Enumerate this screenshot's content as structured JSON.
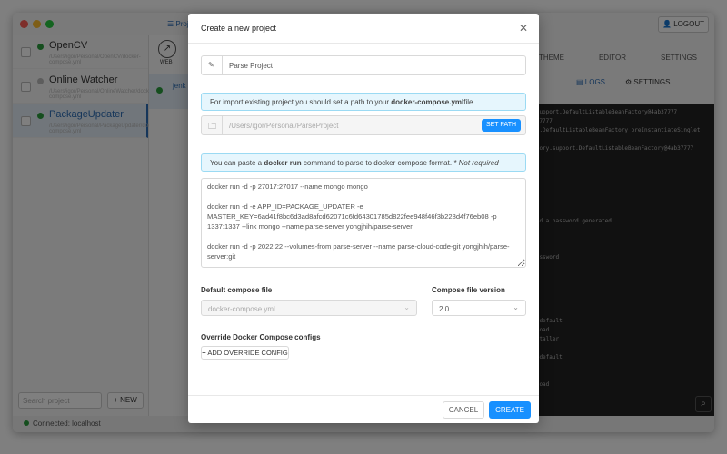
{
  "sidebar": {
    "projects": [
      {
        "name": "OpenCV",
        "subtitle": "/Users/igor/Personal/OpenCV/docker-compose.yml",
        "status_color": "#2a9d3c"
      },
      {
        "name": "Online Watcher",
        "subtitle": "/Users/igor/Personal/OnlineWatcher/docker-compose.yml",
        "status_color": "#bbbbbb"
      },
      {
        "name": "PackageUpdater",
        "subtitle": "/Users/igor/Personal/PackageUpdater/docker-compose.yml",
        "status_color": "#2a9d3c"
      }
    ],
    "search_placeholder": "Search project",
    "new_label": "+ NEW",
    "status": "Connected: localhost"
  },
  "toolbar": {
    "projects_label": "☰ Proj",
    "web_label": "WEB",
    "container": "jenk",
    "logout": "LOGOUT",
    "nav": [
      "THEME",
      "EDITOR",
      "SETTINGS"
    ],
    "logs_tab": "LOGS",
    "settings_tab": "SETTINGS"
  },
  "logs": [
    "...support.DefaultListableBeanFactory@4ab37777",
    "4ab37777",
    "port.DefaultListableBeanFactory preInstantiateSinglet",
    "",
    "factory.support.DefaultListableBeanFactory@4ab37777",
    "",
    "",
    "",
    "",
    "",
    "",
    "",
    "d and a password generated.",
    "",
    "",
    "",
    "inPassword",
    "",
    "",
    "",
    "",
    "",
    "",
    "rce default",
    "le load",
    "nInstaller",
    "",
    "rce default",
    "",
    "",
    "le load",
    "ler"
  ],
  "modal": {
    "title": "Create a new project",
    "name_value": "Parse Project",
    "path_info_pre": "For import existing project you should set a path to your ",
    "path_info_bold": "docker-compose.yml",
    "path_info_post": "file.",
    "path_placeholder": "/Users/igor/Personal/ParseProject",
    "set_path": "SET PATH",
    "run_info_pre": "You can paste a ",
    "run_info_bold": "docker run",
    "run_info_post": " command to parse to docker compose format. ",
    "run_info_em": "* Not required",
    "commands": "docker run -d -p 27017:27017 --name mongo mongo\n\ndocker run -d -e APP_ID=PACKAGE_UPDATER -e MASTER_KEY=6ad41f8bc6d3ad8afcd62071c6fd64301785d822fee948f46f3b228d4f76eb08 -p 1337:1337 --link mongo --name parse-server yongjhih/parse-server\n\ndocker run -d -p 2022:22 --volumes-from parse-server --name parse-cloud-code-git yongjhih/parse-server:git",
    "default_file_label": "Default compose file",
    "default_file_value": "docker-compose.yml",
    "version_label": "Compose file version",
    "version_value": "2.0",
    "override_label": "Override Docker Compose configs",
    "add_override": "ADD OVERRIDE CONFIG",
    "cancel": "CANCEL",
    "create": "CREATE"
  },
  "colors": {
    "accent": "#1890ff"
  }
}
